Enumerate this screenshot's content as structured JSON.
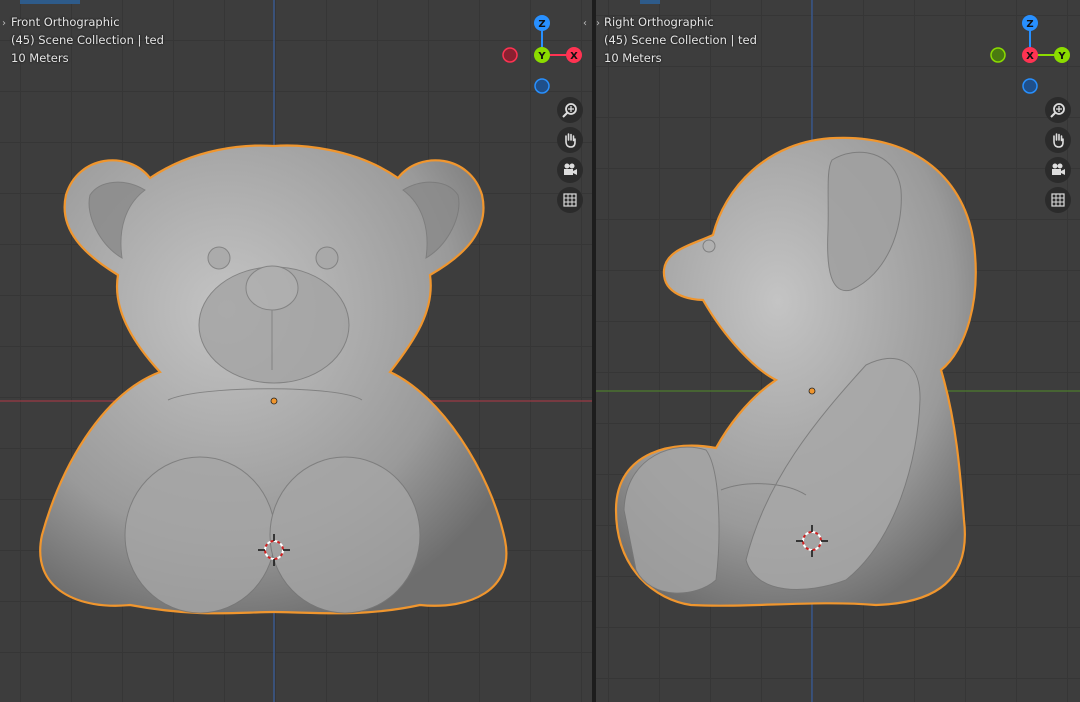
{
  "front_view": {
    "name": "Front Orthographic",
    "collection": "(45) Scene Collection | ted",
    "scale": "10 Meters",
    "gizmo": {
      "top": "Z",
      "center": "Y",
      "right": "X"
    }
  },
  "right_view": {
    "name": "Right Orthographic",
    "collection": "(45) Scene Collection | ted",
    "scale": "10 Meters",
    "gizmo": {
      "top": "Z",
      "center": "X",
      "right": "Y"
    }
  },
  "nav_tools": [
    "zoom-icon",
    "hand-icon",
    "camera-icon",
    "grid-icon"
  ],
  "colors": {
    "axis_x": "#ff3352",
    "axis_y": "#8bdc00",
    "axis_z": "#2890ff",
    "selection_outline": "#f0962e",
    "mesh": "#9a9a9a",
    "background": "#3d3d3d"
  }
}
